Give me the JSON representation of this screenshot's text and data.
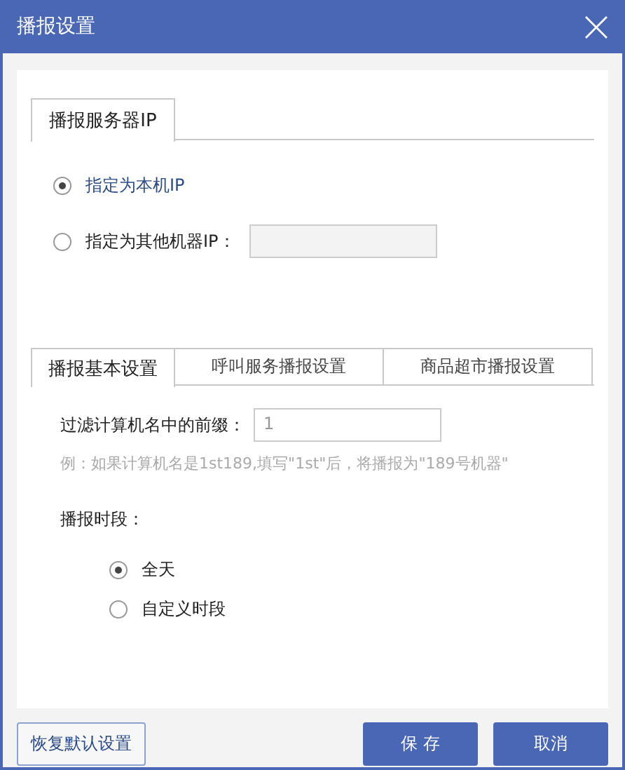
{
  "window": {
    "title": "播报设置"
  },
  "server_section": {
    "tab": "播报服务器IP",
    "options": [
      {
        "label": "指定为本机IP",
        "selected": true,
        "kind": "plain"
      },
      {
        "label": "指定为其他机器IP：",
        "selected": false,
        "kind": "with_field"
      }
    ]
  },
  "settings_tabs": [
    {
      "label": "播报基本设置",
      "selected": true
    },
    {
      "label": "呼叫服务播报设置",
      "selected": false
    },
    {
      "label": "商品超市播报设置",
      "selected": false
    }
  ],
  "prefix_field": {
    "label": "过滤计算机名中的前缀：",
    "value": "1"
  },
  "hint": "例：如果计算机名是1st189,填写\"1st\"后，将播报为\"189号机器\"",
  "period": {
    "label": "播报时段：",
    "options": [
      {
        "label": "全天",
        "selected": true
      },
      {
        "label": "自定义时段",
        "selected": false
      }
    ]
  },
  "buttons": [
    {
      "label": "恢复默认设置",
      "kind": "secondary"
    },
    {
      "label": "保 存",
      "kind": "primary"
    },
    {
      "label": "取消",
      "kind": "primary"
    }
  ]
}
